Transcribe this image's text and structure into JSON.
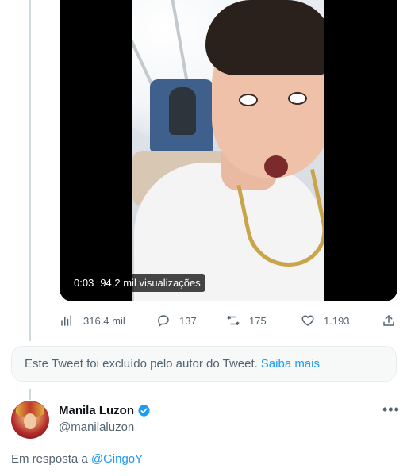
{
  "video": {
    "time": "0:03",
    "views": "94,2 mil visualizações"
  },
  "actions": {
    "views": "316,4 mil",
    "replies": "137",
    "retweets": "175",
    "likes": "1.193"
  },
  "deleted_notice": {
    "text": "Este Tweet foi excluído pelo autor do Tweet.",
    "link": "Saiba mais"
  },
  "reply": {
    "display_name": "Manila Luzon",
    "handle": "@manilaluzon",
    "more": "•••",
    "reply_prefix": "Em resposta a",
    "reply_target": "@GingoY"
  },
  "colors": {
    "accent": "#1d9bf0",
    "secondary_text": "#536471",
    "primary_text": "#0f1419"
  },
  "icons": {
    "views": "bar-chart-icon",
    "reply": "speech-bubble-icon",
    "retweet": "retweet-icon",
    "like": "heart-icon",
    "share": "share-icon",
    "verified": "verified-badge-icon"
  }
}
